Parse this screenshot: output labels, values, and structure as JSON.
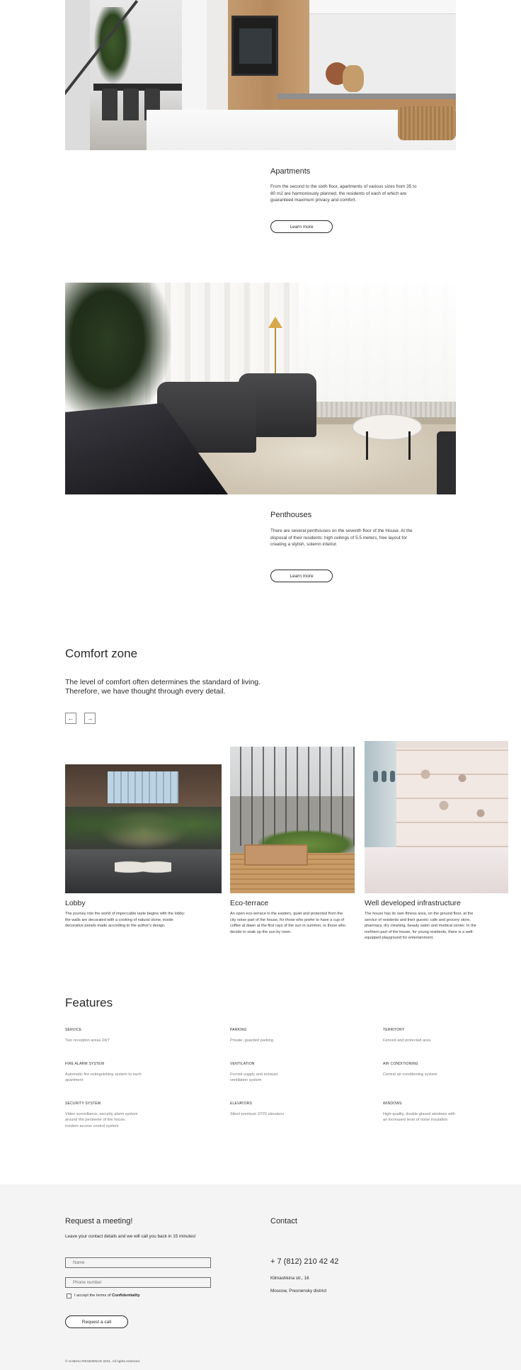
{
  "apartments": {
    "title": "Apartments",
    "text": "From the second to the sixth floor, apartments of various sizes from 35 to 80 m2 are harmoniously planned, the residents of each of which are guaranteed maximum privacy and comfort.",
    "button": "Learn more"
  },
  "penthouses": {
    "title": "Penthouses",
    "text": "There are several penthouses on the seventh floor of the House. At the disposal of their residents: high ceilings of 5.5 meters, free layout for creating a stylish, solemn interior.",
    "button": "Learn more"
  },
  "comfort": {
    "title": "Comfort zone",
    "subtitle": "The level of comfort often determines the standard of living. Therefore, we have thought through every detail.",
    "prev_arrow": "←",
    "next_arrow": "→",
    "slides": [
      {
        "title": "Lobby",
        "text": "The journey into the world of impeccable taste begins with the lobby: the walls are decorated with a cooking of natural stone, inside decorative panels made according to the author's design."
      },
      {
        "title": "Eco-terrace",
        "text": "An open eco-terrace in the eastern, quiet and protected from the city noise part of the house, for those who prefer to have a cup of coffee at dawn at the first rays of the sun in summer, or those who decide to soak up the sun by noon."
      },
      {
        "title": "Well developed infrastructure",
        "text": "The house has its own fitness area, on the ground floor, at the service of residents and their guests: cafe and grocery store, pharmacy, dry cleaning, beauty salon and medical center. In the northern part of the house, for young residents, there is a well-equipped playground for entertainment."
      }
    ]
  },
  "features": {
    "title": "Features",
    "items": [
      {
        "label": "SERVICE",
        "value": "Two reception areas 24/7"
      },
      {
        "label": "PARKING",
        "value": "Private, guarded parking"
      },
      {
        "label": "TERRITORY",
        "value": "Fenced and protected area"
      },
      {
        "label": "FIRE ALARM SYSTEM",
        "value": "Automatic fire extinguishing system to each apartment"
      },
      {
        "label": "VENTILATION",
        "value": "Forced supply and exhaust ventilation system"
      },
      {
        "label": "AIR CONDITIONING",
        "value": "Central air conditioning system"
      },
      {
        "label": "SECURITY SYSTEM",
        "value": "Video surveillance, security alarm system around the perimeter of the house, modern access control system"
      },
      {
        "label": "ELEVATORS",
        "value": "Silent premium OTIS elevators"
      },
      {
        "label": "WINDOWS",
        "value": "High-quality, double-glazed windows with an increased level of noise insulation"
      }
    ]
  },
  "request": {
    "title": "Request a meeting!",
    "subtitle": "Leave your contact details and we will call you back in 15 minutes!",
    "name_placeholder": "Name",
    "phone_placeholder": "Phone number",
    "consent_prefix": "I accept the terms of ",
    "consent_link": "Confidentiality",
    "button": "Request a call"
  },
  "contact": {
    "title": "Contact",
    "phone": "+ 7 (812) 210 42 42",
    "address_line1": "Klimashkina str., 16",
    "address_line2": "Moscow, Presnensky district"
  },
  "footer": {
    "copyright": "© HABIAU RESIDENCE 2021. All rights reserved."
  },
  "colors": {
    "text": "#2a2a2a",
    "muted": "#7a7a7a",
    "footer_bg": "#f4f4f4"
  }
}
